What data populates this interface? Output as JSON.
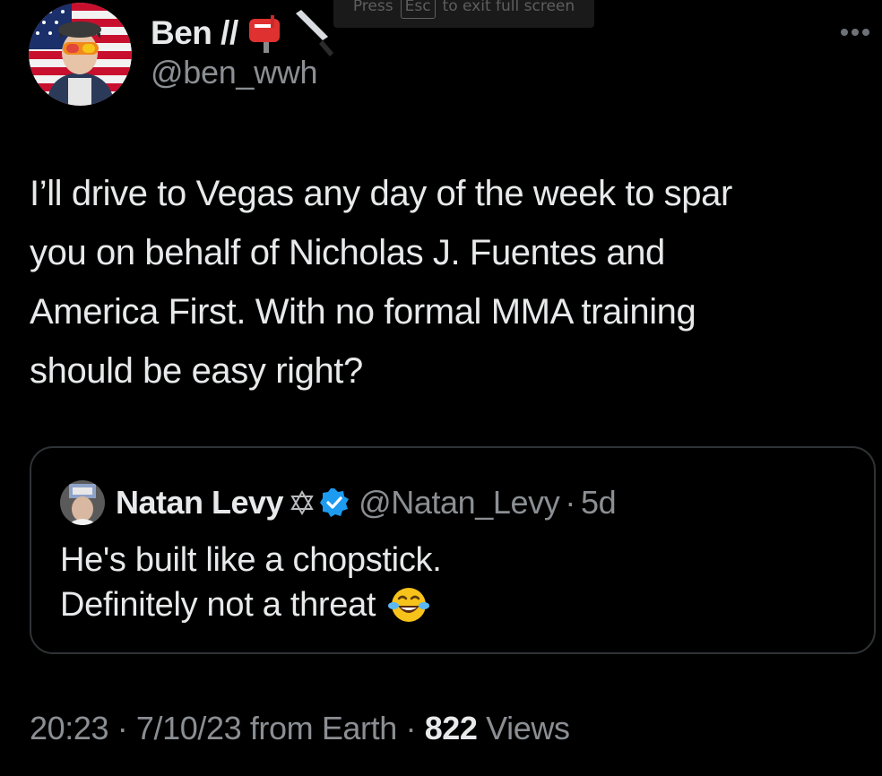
{
  "fullscreen_hint": {
    "press": "Press",
    "key": "Esc",
    "rest": "to exit full screen"
  },
  "tweet": {
    "author": {
      "name": "Ben //",
      "handle": "@ben_wwh",
      "name_emojis": [
        "postbox-icon",
        "knife-icon"
      ]
    },
    "text_lines": [
      "I’ll drive to Vegas any day of the week to spar",
      "you on behalf of Nicholas J. Fuentes and",
      "America First. With no formal MMA training",
      "should be easy right?"
    ],
    "quoted": {
      "name": "Natan Levy",
      "handle": "@Natan_Levy",
      "dot": "·",
      "age": "5d",
      "text_lines": [
        "He's built like a chopstick.",
        "Definitely not a threat"
      ],
      "emoji": "face-with-tears-of-joy-icon"
    },
    "meta": {
      "time": "20:23",
      "sep1": "·",
      "date": "7/10/23 from Earth",
      "sep2": "·",
      "views_count": "822",
      "views_label": "Views"
    }
  },
  "colors": {
    "background": "#000000",
    "text": "#e7e9ea",
    "muted": "#8b8f93",
    "border": "#2f3336",
    "verified": "#1d9bf0"
  }
}
